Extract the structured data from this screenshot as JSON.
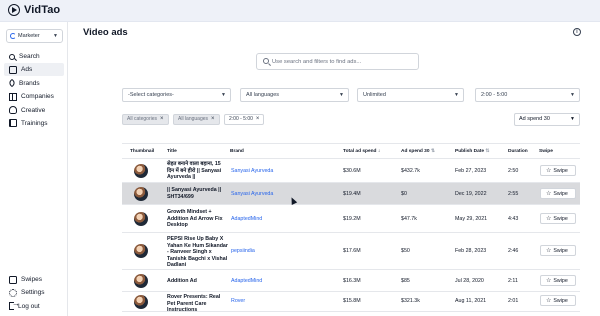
{
  "app": {
    "name": "VidTao"
  },
  "sidebar": {
    "role": "Marketer",
    "top_items": [
      {
        "label": "Search",
        "icon": "search-icon",
        "active": false
      },
      {
        "label": "Ads",
        "icon": "ads-icon",
        "active": true
      },
      {
        "label": "Brands",
        "icon": "tag-icon",
        "active": false
      },
      {
        "label": "Companies",
        "icon": "building-icon",
        "active": false
      },
      {
        "label": "Creative",
        "icon": "bulb-icon",
        "active": false
      },
      {
        "label": "Trainings",
        "icon": "book-icon",
        "active": false
      }
    ],
    "bottom_items": [
      {
        "label": "Swipes",
        "icon": "swipe-icon"
      },
      {
        "label": "Settings",
        "icon": "gear-icon"
      },
      {
        "label": "Log out",
        "icon": "logout-icon"
      }
    ]
  },
  "main": {
    "title": "Video ads",
    "search_placeholder": "Use search and filters to find ads...",
    "filters": {
      "category": "-Select categories-",
      "language": "All languages",
      "limit": "Unlimited",
      "duration": "2:00 - 5:00"
    },
    "chips": [
      "All categories",
      "All languages",
      "2:00 - 5:00"
    ],
    "sort": "Ad spend 30",
    "table": {
      "headers": {
        "thumbnail": "Thumbnail",
        "title": "Title",
        "brand": "Brand",
        "total": "Total ad spend",
        "spend30": "Ad spend 30",
        "date": "Publish Date",
        "duration": "Duration",
        "swipe": "Swipe"
      },
      "swipe_label": "Swipe",
      "rows": [
        {
          "title": "सेहत बनाने वाला बहाना, 15 दिन में बने हीरो || Sanyasi Ayurveda ||",
          "brand": "Sanyasi Ayurveda",
          "total": "$30.6M",
          "spend30": "$432.7k",
          "date": "Feb 27, 2023",
          "duration": "2:50"
        },
        {
          "title": "|| Sanyasi Ayurveda || SHT34/699",
          "brand": "Sanyasi Ayurveda",
          "total": "$19.4M",
          "spend30": "$0",
          "date": "Dec 19, 2022",
          "duration": "2:55"
        },
        {
          "title": "Growth Mindset + Addition Ad Arrow Fix Desktop",
          "brand": "AdaptedMind",
          "total": "$19.2M",
          "spend30": "$47.7k",
          "date": "May 29, 2021",
          "duration": "4:43"
        },
        {
          "title": "PEPSI Rise Up Baby X Yahan Ke Hum Sikandar - Ranveer Singh x Tanishk Bagchi x Vishal Dadlani",
          "brand": "pepsiindia",
          "total": "$17.6M",
          "spend30": "$50",
          "date": "Feb 28, 2023",
          "duration": "2:46"
        },
        {
          "title": "Addition Ad",
          "brand": "AdaptedMind",
          "total": "$16.3M",
          "spend30": "$85",
          "date": "Jul 28, 2020",
          "duration": "2:11"
        },
        {
          "title": "Rover Presents: Real Pet Parent Care Instructions",
          "brand": "Rover",
          "total": "$15.8M",
          "spend30": "$321.3k",
          "date": "Aug 11, 2021",
          "duration": "2:01"
        }
      ]
    }
  }
}
